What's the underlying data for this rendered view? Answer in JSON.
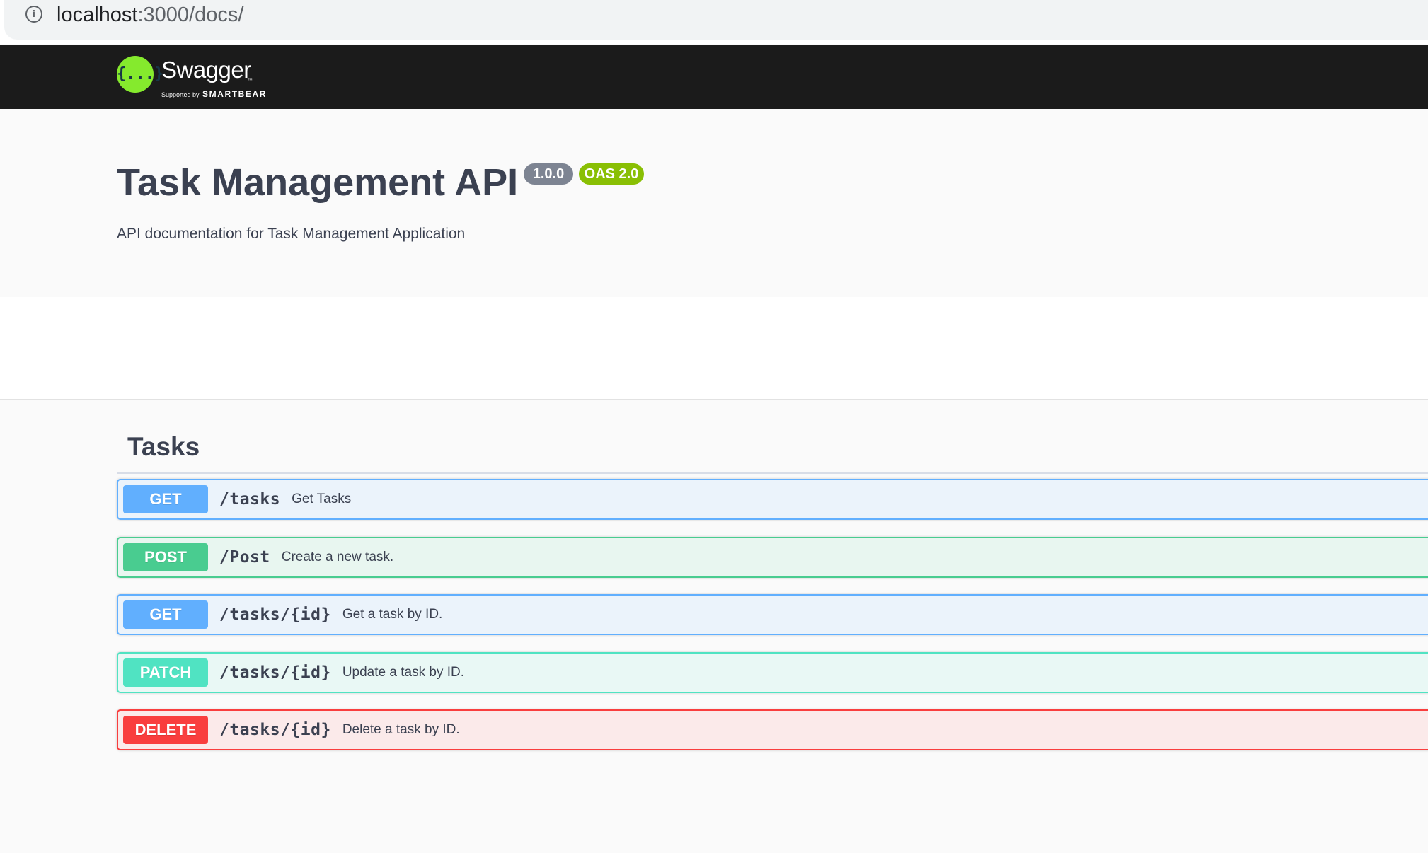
{
  "browser": {
    "url_host": "localhost",
    "url_path": ":3000/docs/",
    "info_icon": "info-icon"
  },
  "topbar": {
    "logo_icon": "{...}",
    "logo_text": "Swagger",
    "logo_tm": "™",
    "supported_by": "Supported by",
    "brand": "SMARTBEAR"
  },
  "info": {
    "title": "Task Management API",
    "version_badge": "1.0.0",
    "oas_badge": "OAS 2.0",
    "description": "API documentation for Task Management Application"
  },
  "tags": [
    {
      "name": "Tasks",
      "operations": [
        {
          "method": "GET",
          "path": "/tasks",
          "summary": "Get Tasks"
        },
        {
          "method": "POST",
          "path": "/Post",
          "summary": "Create a new task."
        },
        {
          "method": "GET",
          "path": "/tasks/{id}",
          "summary": "Get a task by ID."
        },
        {
          "method": "PATCH",
          "path": "/tasks/{id}",
          "summary": "Update a task by ID."
        },
        {
          "method": "DELETE",
          "path": "/tasks/{id}",
          "summary": "Delete a task by ID."
        }
      ]
    }
  ],
  "colors": {
    "get": "#61affe",
    "post": "#49cc90",
    "patch": "#50e3c2",
    "delete": "#f93e3e",
    "topbar": "#1b1b1b",
    "logo": "#85ea2d",
    "version_badge": "#7d8492",
    "oas_badge": "#89bf04"
  }
}
